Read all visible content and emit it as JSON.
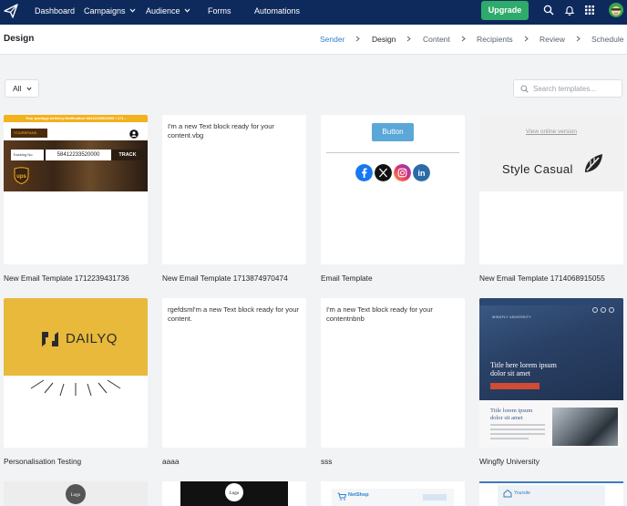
{
  "nav": {
    "items": [
      {
        "label": "Dashboard"
      },
      {
        "label": "Campaigns"
      },
      {
        "label": "Audience"
      },
      {
        "label": "Forms"
      },
      {
        "label": "Automations"
      }
    ],
    "upgrade_label": "Upgrade",
    "icons": [
      "search-icon",
      "bell-icon",
      "apps-grid-icon",
      "avatar"
    ]
  },
  "subheader": {
    "title": "Design",
    "steps": [
      {
        "label": "Sender",
        "state": "done"
      },
      {
        "label": "Design",
        "state": "current"
      },
      {
        "label": "Content",
        "state": "todo"
      },
      {
        "label": "Recipients",
        "state": "todo"
      },
      {
        "label": "Review",
        "state": "todo"
      },
      {
        "label": "Schedule",
        "state": "todo"
      }
    ]
  },
  "filters": {
    "category_value": "All",
    "search_placeholder": "Search templates..."
  },
  "templates": [
    {
      "name": "New Email Template 1712239431736",
      "preview": {
        "banner": "Your package delivery Notification 58412233520000 / 171...",
        "logo_text": "YOURBRAND",
        "tracking_label": "Tracking No.",
        "tracking_number": "58412233520000",
        "track_button": "TRACK"
      }
    },
    {
      "name": "New Email Template 1713874970474",
      "preview": {
        "text": "I'm a new Text block ready for your content.vbg"
      }
    },
    {
      "name": "Email Template",
      "preview": {
        "button_label": "Button",
        "social": [
          "facebook-icon",
          "x-icon",
          "instagram-icon",
          "linkedin-icon"
        ]
      }
    },
    {
      "name": "New Email Template 1714068915055",
      "preview": {
        "view_online": "View online version",
        "brand": "Style Casual"
      }
    },
    {
      "name": "Personalisation Testing",
      "preview": {
        "brand": "DAILYQ"
      }
    },
    {
      "name": "aaaa",
      "preview": {
        "text": "rgefdsml'm a new Text block ready for your content."
      }
    },
    {
      "name": "sss",
      "preview": {
        "text": "I'm a new Text block ready for your contentnbnb"
      }
    },
    {
      "name": "Wingfly University",
      "preview": {
        "brand": "WINGFLY UNIVERSITY",
        "hero_title": "Title here lorem ipsum dolor sit amet",
        "section_title": "Title lorem ipsum dolor sit amet"
      }
    }
  ],
  "partial_row": [
    {
      "preview_label": "Logo"
    },
    {
      "preview_label": "Logo"
    },
    {
      "preview_label": "NetShop"
    },
    {
      "preview_label": "Yoursite"
    }
  ],
  "colors": {
    "nav_bg": "#0e2a5c",
    "upgrade_bg": "#2eab6b",
    "active_step": "#2f7fd1",
    "page_bg": "#f2f3f5"
  }
}
